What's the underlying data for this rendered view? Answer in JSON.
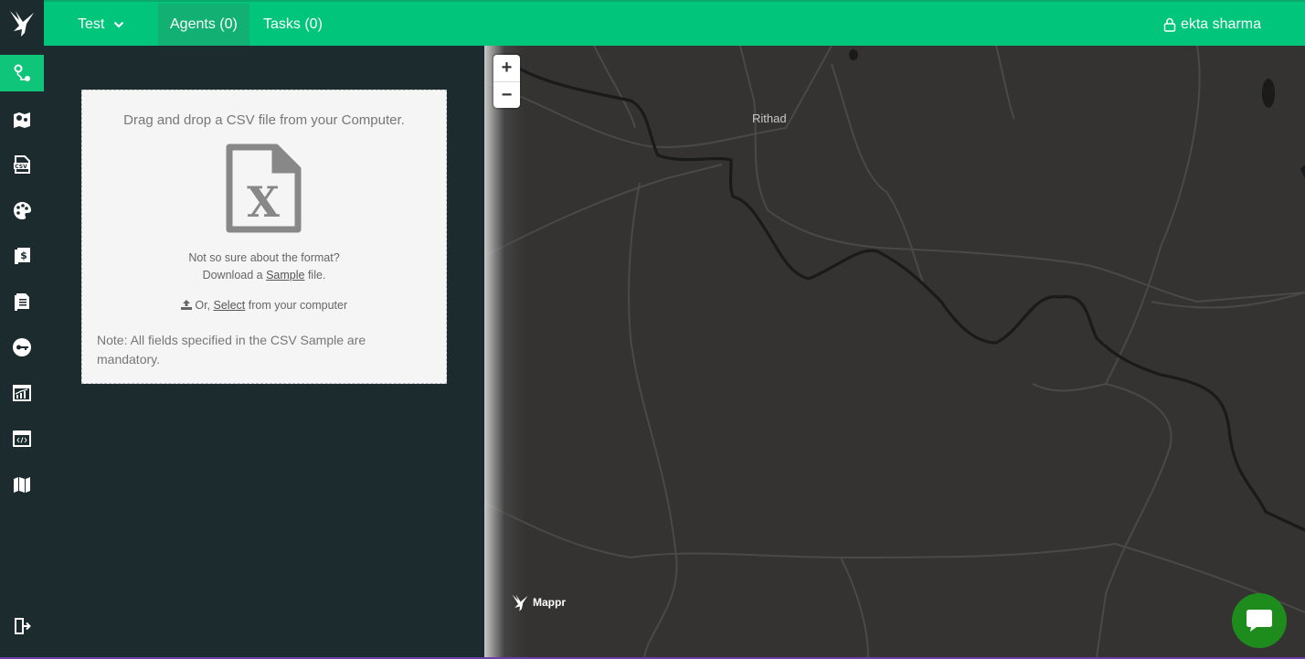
{
  "topbar": {
    "project": "Test",
    "agents": "Agents (0)",
    "tasks": "Tasks (0)",
    "user": "ekta sharma"
  },
  "rail": {
    "items": [
      {
        "icon": "route-pin-icon",
        "active": true
      },
      {
        "icon": "map-pins-icon",
        "active": false
      },
      {
        "icon": "csv-file-icon",
        "active": false
      },
      {
        "icon": "palette-icon",
        "active": false
      },
      {
        "icon": "billing-icon",
        "active": false
      },
      {
        "icon": "document-icon",
        "active": false
      },
      {
        "icon": "key-icon",
        "active": false
      },
      {
        "icon": "analytics-icon",
        "active": false
      },
      {
        "icon": "code-window-icon",
        "active": false
      },
      {
        "icon": "map-icon",
        "active": false
      }
    ],
    "logout_icon": "logout-icon"
  },
  "upload": {
    "title": "Drag and drop a CSV file from your Computer.",
    "icon": "excel-file-icon",
    "hint_line1": "Not so sure about the format?",
    "hint_download": "Download a",
    "hint_sample": "Sample",
    "hint_file": "file.",
    "select_or": "Or,",
    "select_link": "Select",
    "select_rest": "from your computer",
    "note": "Note: All fields specified in the CSV Sample are mandatory."
  },
  "map": {
    "zoom_in": "+",
    "zoom_out": "−",
    "place": "Rithad",
    "brand": "Mappr"
  },
  "colors": {
    "accent": "#00c57b",
    "rail": "#1c2b2d",
    "map": "#343332",
    "chat": "#1d8c1d"
  }
}
